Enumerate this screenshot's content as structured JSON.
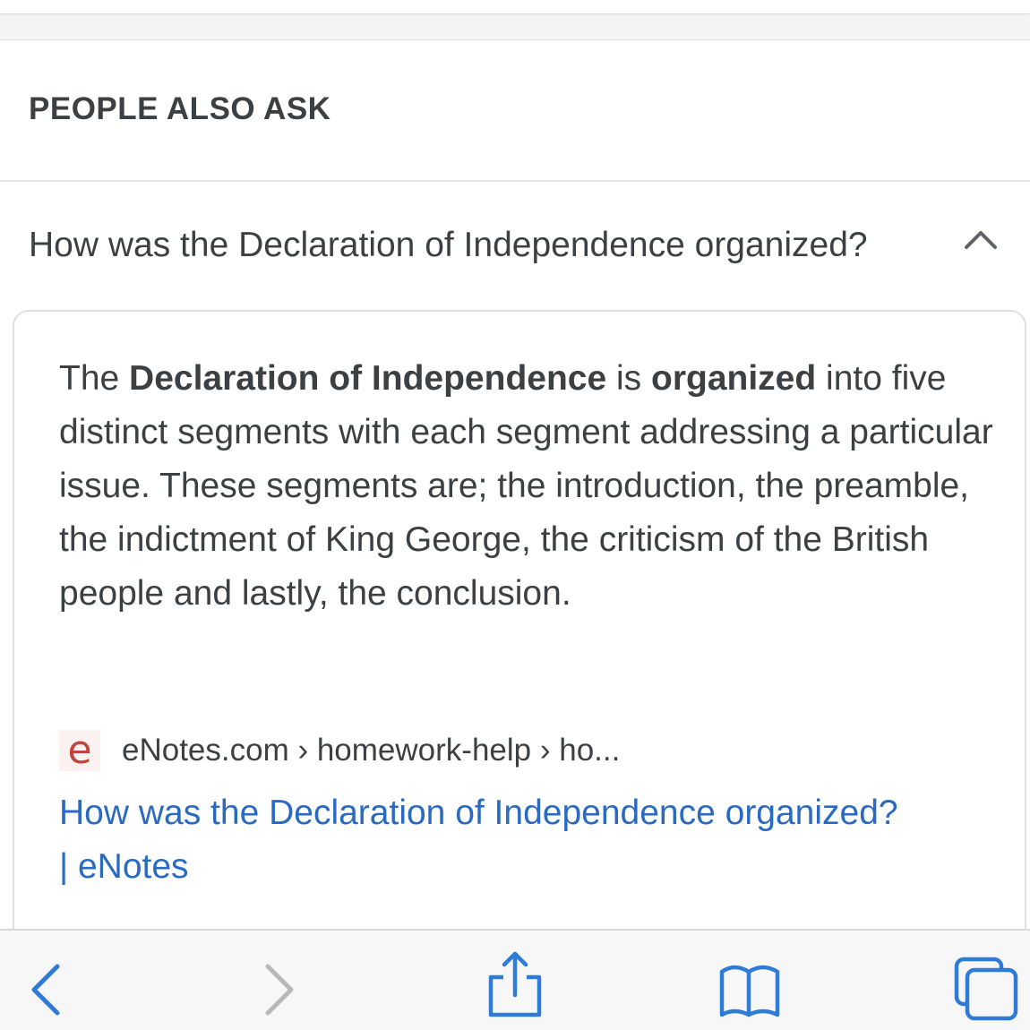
{
  "paa": {
    "header": "PEOPLE ALSO ASK",
    "question": "How was the Declaration of Independence organized?",
    "answer": {
      "part1": "The ",
      "bold1": "Declaration of Independence",
      "part2": " is ",
      "bold2": "organized",
      "part3": " into five distinct segments with each segment addressing a particular issue. These segments are; the introduction, the preamble, the indictment of King George, the criticism of the British people and lastly, the conclusion."
    },
    "source": {
      "favicon_letter": "e",
      "path": "eNotes.com › homework-help › ho..."
    },
    "link": {
      "line1": "How was the Declaration of Independence organized?",
      "line2": "| eNotes"
    }
  },
  "toolbar": {
    "back_icon": "back-arrow-icon",
    "forward_icon": "forward-arrow-icon",
    "share_icon": "share-icon",
    "bookmarks_icon": "bookmarks-icon",
    "tabs_icon": "tabs-icon",
    "accent_color": "#2f7bd8",
    "disabled_color": "#b8b8b8"
  },
  "colors": {
    "link": "#2a6ac2",
    "text": "#3c4043"
  }
}
